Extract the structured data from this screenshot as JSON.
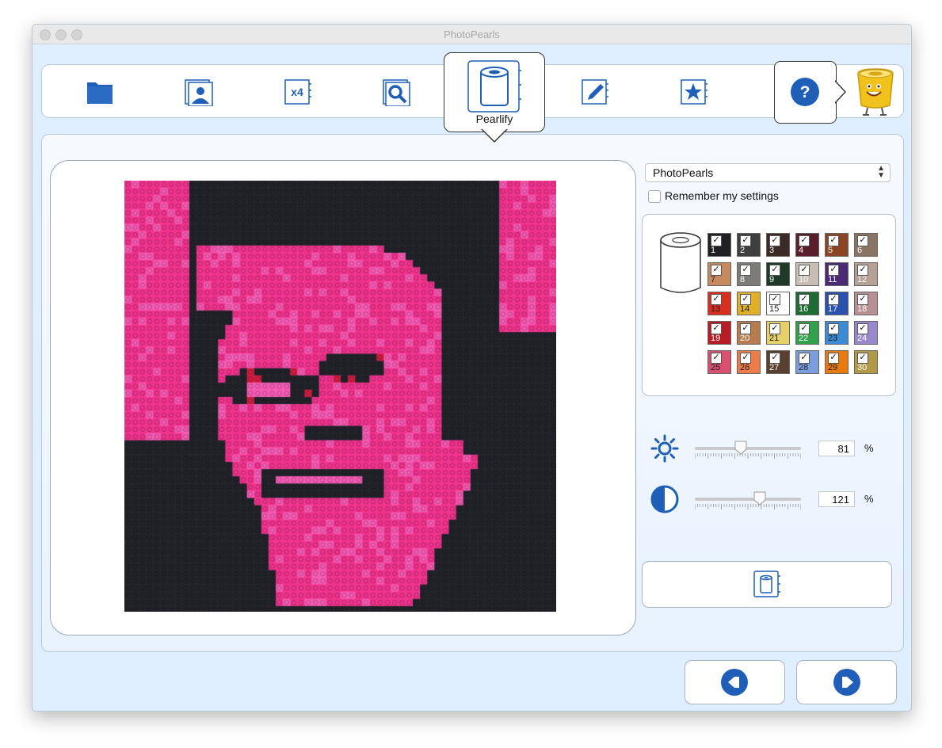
{
  "window": {
    "title": "PhotoPearls"
  },
  "toolbar": {
    "tools": [
      {
        "name": "folder-icon"
      },
      {
        "name": "photo-icon"
      },
      {
        "name": "x4-icon",
        "label": "x4"
      },
      {
        "name": "zoom-icon"
      },
      {
        "name": "pearlify-icon"
      },
      {
        "name": "edit-icon"
      },
      {
        "name": "favorites-icon"
      }
    ],
    "active_label": "Pearlify",
    "help_label": "?"
  },
  "settings": {
    "preset": "PhotoPearls",
    "remember_label": "Remember my settings",
    "remember_checked": false
  },
  "palette": {
    "colors": [
      {
        "n": "1",
        "hex": "#1f1f24",
        "text": "#ffffff"
      },
      {
        "n": "2",
        "hex": "#3f3f3f",
        "text": "#ffffff"
      },
      {
        "n": "3",
        "hex": "#3b2a26",
        "text": "#ffffff"
      },
      {
        "n": "4",
        "hex": "#5a1e2a",
        "text": "#ffffff"
      },
      {
        "n": "5",
        "hex": "#8b4522",
        "text": "#ffffff"
      },
      {
        "n": "6",
        "hex": "#8a7464",
        "text": "#ffffff"
      },
      {
        "n": "7",
        "hex": "#c58a5e",
        "text": "#222222"
      },
      {
        "n": "8",
        "hex": "#7d7b78",
        "text": "#ffffff"
      },
      {
        "n": "9",
        "hex": "#1f3b28",
        "text": "#ffffff"
      },
      {
        "n": "10",
        "hex": "#c6bdb5",
        "text": "#ffffff"
      },
      {
        "n": "11",
        "hex": "#4d2a76",
        "text": "#ffffff"
      },
      {
        "n": "12",
        "hex": "#b6a095",
        "text": "#ffffff"
      },
      {
        "n": "13",
        "hex": "#d62f1f",
        "text": "#222222"
      },
      {
        "n": "14",
        "hex": "#e0b028",
        "text": "#222222"
      },
      {
        "n": "15",
        "hex": "#ffffff",
        "text": "#222222"
      },
      {
        "n": "16",
        "hex": "#1f6b34",
        "text": "#ffffff"
      },
      {
        "n": "17",
        "hex": "#2a50b0",
        "text": "#ffffff"
      },
      {
        "n": "18",
        "hex": "#b89094",
        "text": "#ffffff"
      },
      {
        "n": "19",
        "hex": "#b51c24",
        "text": "#ffffff"
      },
      {
        "n": "20",
        "hex": "#b77b4e",
        "text": "#ffffff"
      },
      {
        "n": "21",
        "hex": "#e6d06a",
        "text": "#222222"
      },
      {
        "n": "22",
        "hex": "#33a04a",
        "text": "#ffffff"
      },
      {
        "n": "23",
        "hex": "#3a8ad4",
        "text": "#222222"
      },
      {
        "n": "24",
        "hex": "#9a88cc",
        "text": "#ffffff"
      },
      {
        "n": "25",
        "hex": "#d95070",
        "text": "#222222"
      },
      {
        "n": "26",
        "hex": "#ec7c48",
        "text": "#222222"
      },
      {
        "n": "27",
        "hex": "#5a4030",
        "text": "#ffffff"
      },
      {
        "n": "28",
        "hex": "#7a9edc",
        "text": "#222222"
      },
      {
        "n": "29",
        "hex": "#e87a10",
        "text": "#222222"
      },
      {
        "n": "30",
        "hex": "#b09a48",
        "text": "#ffffff"
      }
    ]
  },
  "adjustments": {
    "brightness": {
      "value": "81",
      "unit": "%",
      "fraction": 0.43,
      "icon": "brightness-icon"
    },
    "contrast": {
      "value": "121",
      "unit": "%",
      "fraction": 0.61,
      "icon": "contrast-icon"
    }
  },
  "preview": {
    "bead_colors": {
      "dark": "#23232b",
      "pink": "#f0348e",
      "pink_light": "#f65cb4",
      "red": "#d21e40"
    }
  },
  "colors": {
    "window_bg": "#dfeeff",
    "accent_blue": "#1f5fb8"
  },
  "navigation": {
    "back_icon": "back-arrow-icon",
    "next_icon": "next-arrow-icon"
  }
}
